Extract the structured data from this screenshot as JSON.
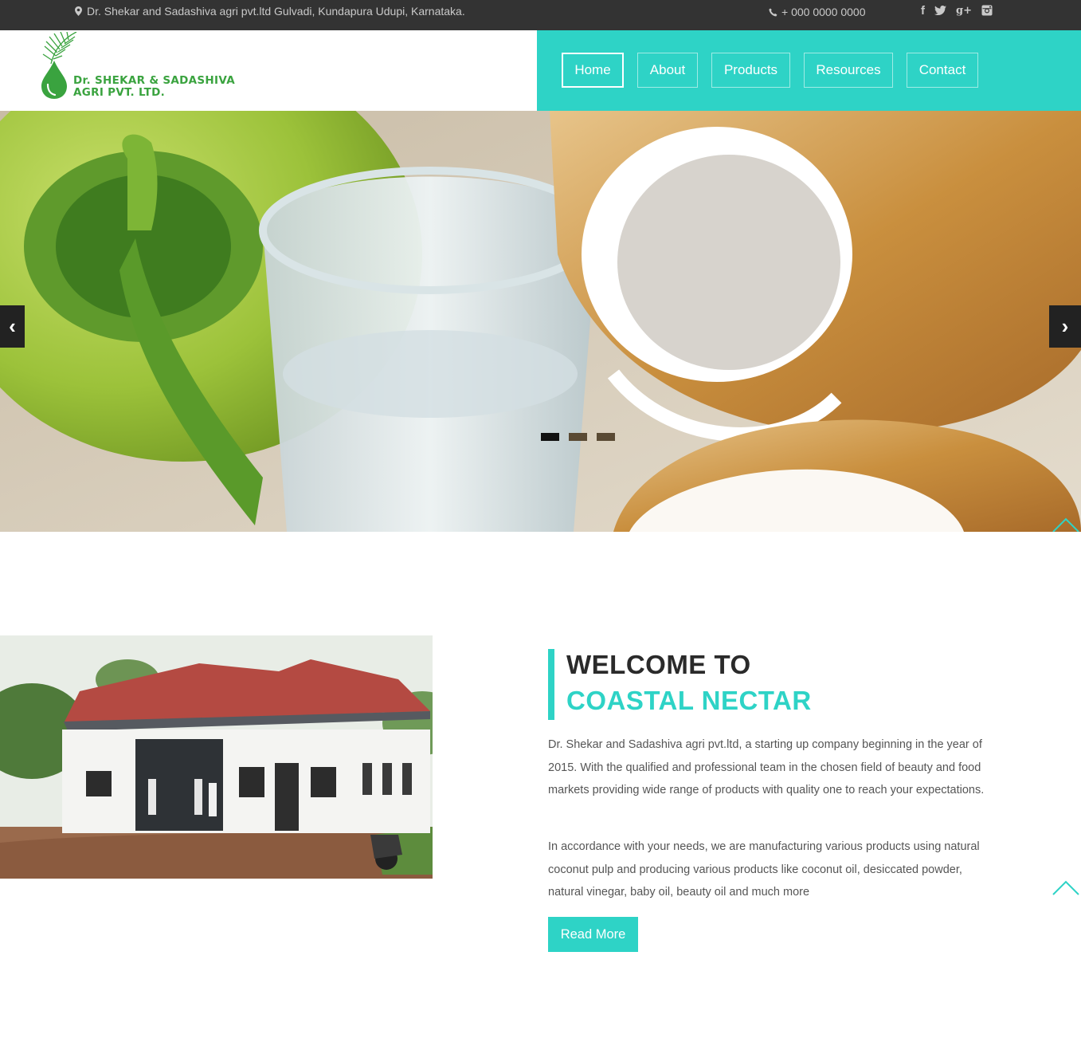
{
  "topbar": {
    "address": "Dr. Shekar and Sadashiva agri pvt.ltd Gulvadi, Kundapura Udupi, Karnataka.",
    "phone": "+ 000 0000 0000",
    "social": [
      "facebook-icon",
      "twitter-icon",
      "google-plus-icon",
      "instagram-icon"
    ]
  },
  "brand": {
    "line1": "Dr. SHEKAR & SADASHIVA",
    "line2": "AGRI PVT. LTD."
  },
  "nav": {
    "items": [
      {
        "label": "Home",
        "active": true
      },
      {
        "label": "About",
        "active": false
      },
      {
        "label": "Products",
        "active": false
      },
      {
        "label": "Resources",
        "active": false
      },
      {
        "label": "Contact",
        "active": false
      }
    ]
  },
  "slider": {
    "prev": "‹",
    "next": "›",
    "slide_count": 3,
    "active_slide": 1
  },
  "welcome": {
    "heading_line1": "WELCOME TO",
    "heading_line2": "COASTAL NECTAR",
    "paragraph1": "Dr. Shekar and Sadashiva agri pvt.ltd, a starting up company beginning in the year of 2015. With the qualified and professional team in the chosen field of beauty and food markets providing wide range of products with quality one to reach your expectations.",
    "paragraph2": "In accordance with your needs, we are manufacturing various products using natural coconut pulp and producing various products like coconut oil, desiccated powder, natural vinegar, baby oil, beauty oil and much more",
    "read_more": "Read More"
  },
  "colors": {
    "accent": "#2ed3c6",
    "topbar": "#333333",
    "brand_green": "#3aa33f"
  }
}
